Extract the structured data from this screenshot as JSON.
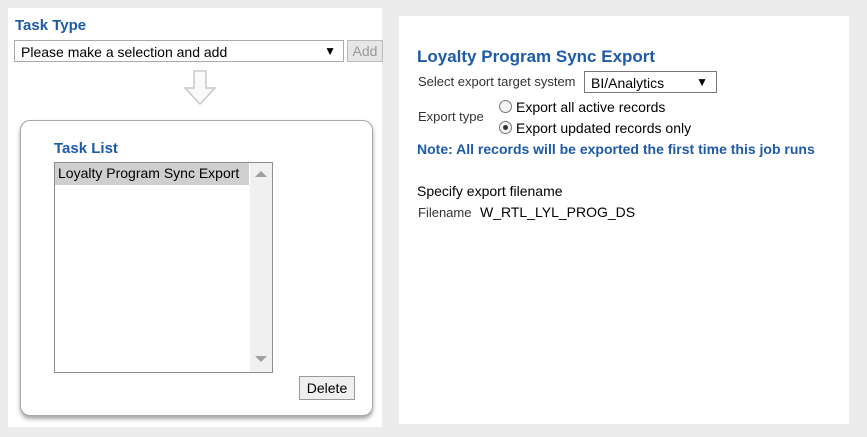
{
  "task_type": {
    "label": "Task Type",
    "select_value": "Please make a selection and add",
    "add_label": "Add"
  },
  "task_list": {
    "label": "Task List",
    "items": [
      "Loyalty Program Sync Export"
    ],
    "delete_label": "Delete"
  },
  "export": {
    "title": "Loyalty Program Sync Export",
    "target_label": "Select export target system",
    "target_value": "BI/Analytics",
    "type_label": "Export type",
    "options": [
      "Export all active records",
      "Export updated records only"
    ],
    "selected_option": 1,
    "note": "Note: All records will be exported the first time this job runs",
    "filename_heading": "Specify export filename",
    "filename_label": "Filename",
    "filename_value": "W_RTL_LYL_PROG_DS"
  },
  "colors": {
    "accent": "#1d5aa8",
    "panel_bg": "#ececec"
  }
}
